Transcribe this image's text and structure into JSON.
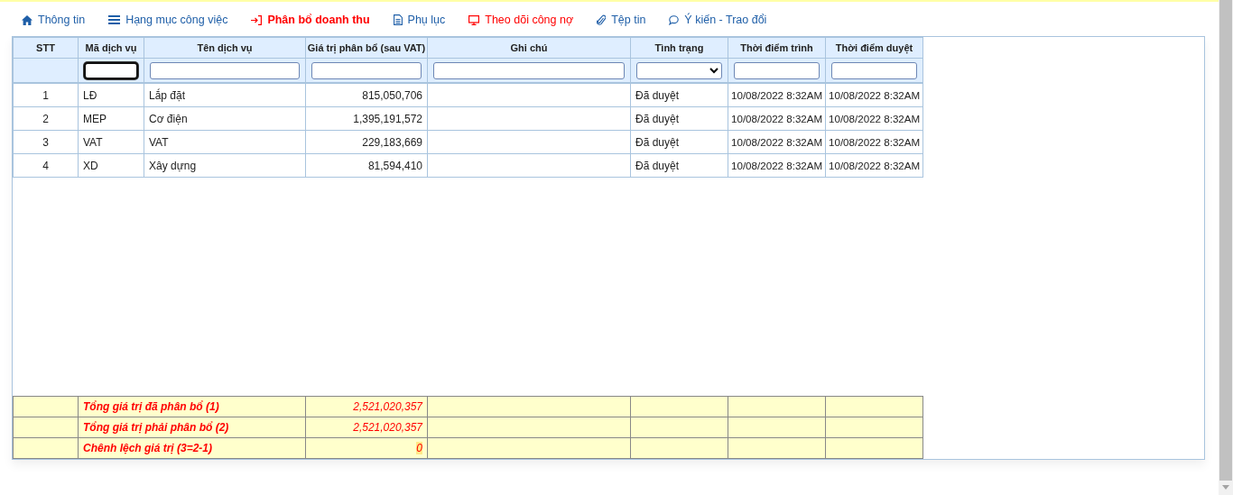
{
  "tabs": [
    {
      "label": "Thông tin",
      "selected": false,
      "color": "#1f5fa8"
    },
    {
      "label": "Hạng mục công việc",
      "selected": false,
      "color": "#1f5fa8"
    },
    {
      "label": "Phân bổ doanh thu",
      "selected": true,
      "color": "#ff0000"
    },
    {
      "label": "Phụ lục",
      "selected": false,
      "color": "#1f5fa8"
    },
    {
      "label": "Theo dõi công nợ",
      "selected": false,
      "color": "#ff0000"
    },
    {
      "label": "Tệp tin",
      "selected": false,
      "color": "#1f5fa8"
    },
    {
      "label": "Ý kiến - Trao đổi",
      "selected": false,
      "color": "#1f5fa8"
    }
  ],
  "table": {
    "columns": [
      "STT",
      "Mã dịch vụ",
      "Tên dịch vụ",
      "Giá trị phân bổ (sau VAT)",
      "Ghi chú",
      "Tình trạng",
      "Thời điểm trình",
      "Thời điểm duyệt"
    ],
    "filters": [
      {
        "kind": "blank"
      },
      {
        "kind": "text",
        "focused": true
      },
      {
        "kind": "text",
        "focused": false
      },
      {
        "kind": "text",
        "focused": false
      },
      {
        "kind": "text",
        "focused": false
      },
      {
        "kind": "select",
        "focused": false
      },
      {
        "kind": "text",
        "focused": false
      },
      {
        "kind": "text",
        "focused": false
      }
    ],
    "rows": [
      [
        "1",
        "LĐ",
        "Lắp đặt",
        "815,050,706",
        "",
        "Đã duyệt",
        "10/08/2022 8:32AM",
        "10/08/2022 8:32AM"
      ],
      [
        "2",
        "MEP",
        "Cơ điện",
        "1,395,191,572",
        "",
        "Đã duyệt",
        "10/08/2022 8:32AM",
        "10/08/2022 8:32AM"
      ],
      [
        "3",
        "VAT",
        "VAT",
        "229,183,669",
        "",
        "Đã duyệt",
        "10/08/2022 8:32AM",
        "10/08/2022 8:32AM"
      ],
      [
        "4",
        "XD",
        "Xây dựng",
        "81,594,410",
        "",
        "Đã duyệt",
        "10/08/2022 8:32AM",
        "10/08/2022 8:32AM"
      ]
    ],
    "totals": [
      {
        "label": "Tổng giá trị đã phân bổ (1)",
        "value": "2,521,020,357",
        "highlighted": false
      },
      {
        "label": "Tổng giá trị phải phân bổ (2)",
        "value": "2,521,020,357",
        "highlighted": false
      },
      {
        "label": "Chênh lệch giá trị (3=2-1)",
        "value": "0",
        "highlighted": true
      }
    ]
  }
}
